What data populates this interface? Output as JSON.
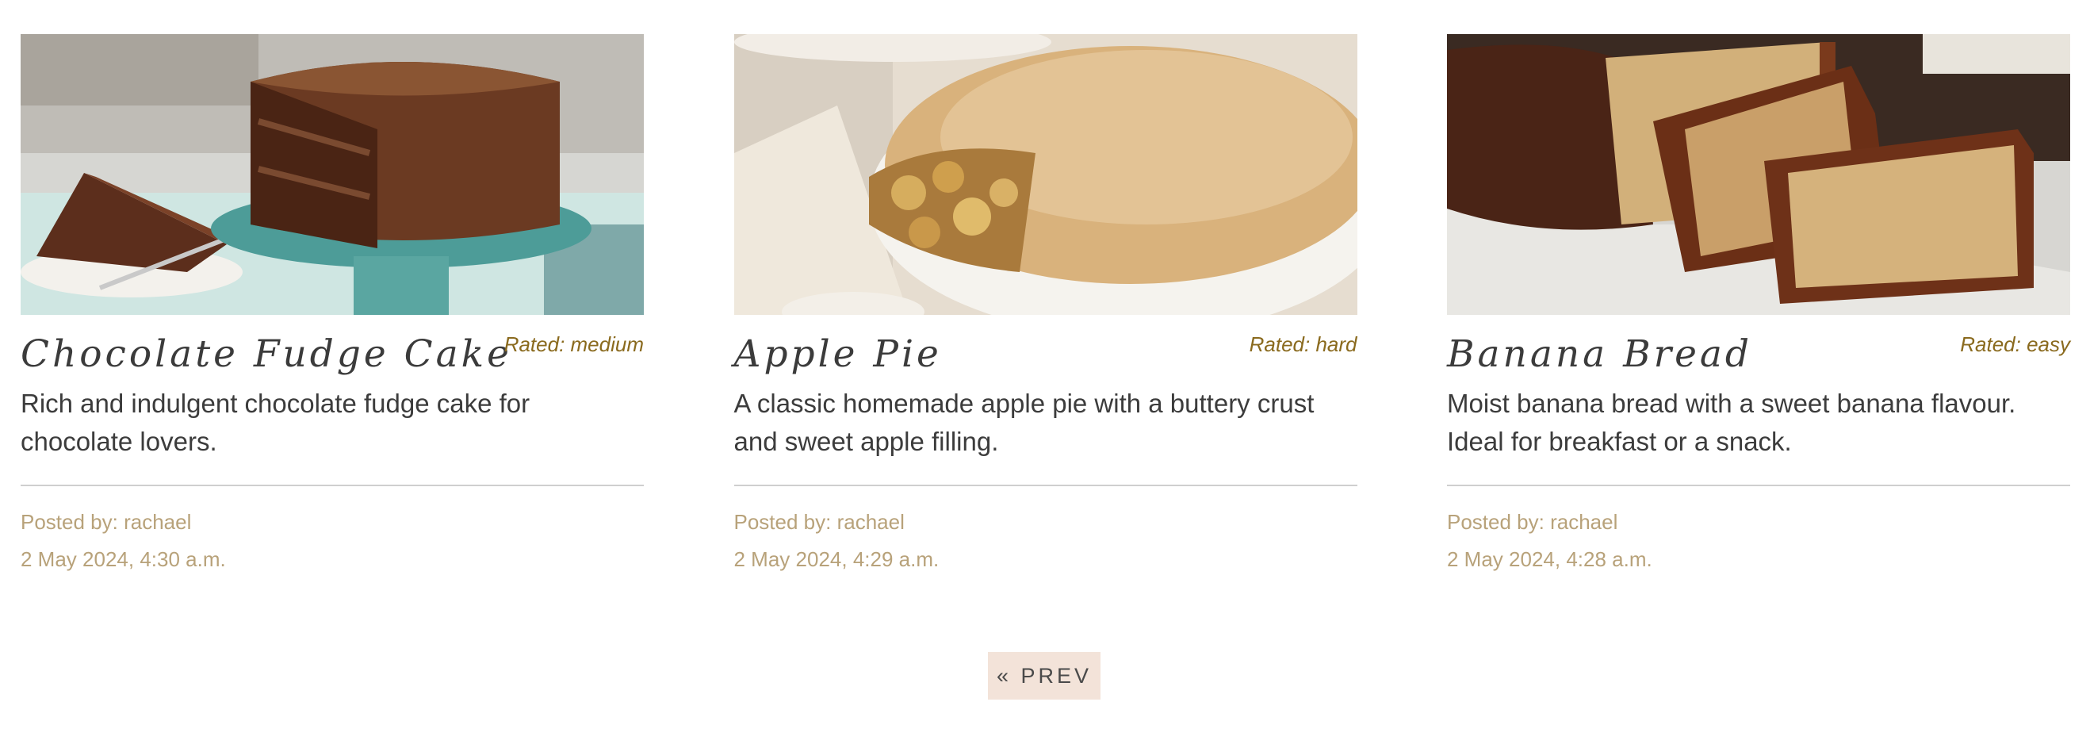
{
  "recipes": [
    {
      "title": "Chocolate Fudge Cake",
      "rating": "Rated: medium",
      "description": "Rich and indulgent chocolate fudge cake for chocolate lovers.",
      "posted_by": "Posted by: rachael",
      "date": "2 May 2024, 4:30 a.m.",
      "image": "chocolate-fudge-cake-photo"
    },
    {
      "title": "Apple Pie",
      "rating": "Rated: hard",
      "description": "A classic homemade apple pie with a buttery crust and sweet apple filling.",
      "posted_by": "Posted by: rachael",
      "date": "2 May 2024, 4:29 a.m.",
      "image": "apple-pie-photo"
    },
    {
      "title": "Banana Bread",
      "rating": "Rated: easy",
      "description": "Moist banana bread with a sweet banana flavour. Ideal for breakfast or a snack.",
      "posted_by": "Posted by: rachael",
      "date": "2 May 2024, 4:28 a.m.",
      "image": "banana-bread-photo"
    }
  ],
  "pagination": {
    "prev_label": "« PREV"
  },
  "colors": {
    "title": "#3b3b3b",
    "rating": "#8a6a1e",
    "meta": "#b8a27a",
    "divider": "#cfcfcf",
    "pagination_bg": "#f3e3d9"
  }
}
